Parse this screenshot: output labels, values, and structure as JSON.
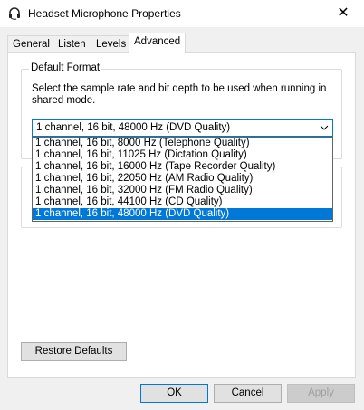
{
  "window": {
    "title": "Headset Microphone Properties",
    "close_label": "✕"
  },
  "tabs": [
    {
      "label": "General"
    },
    {
      "label": "Listen"
    },
    {
      "label": "Levels"
    },
    {
      "label": "Advanced",
      "active": true
    }
  ],
  "default_format": {
    "group_label": "Default Format",
    "description": "Select the sample rate and bit depth to be used when running in shared mode.",
    "selected_value": "1 channel, 16 bit, 48000 Hz (DVD Quality)",
    "options": [
      "1 channel, 16 bit, 8000 Hz (Telephone Quality)",
      "1 channel, 16 bit, 11025 Hz (Dictation Quality)",
      "1 channel, 16 bit, 16000 Hz (Tape Recorder Quality)",
      "1 channel, 16 bit, 22050 Hz (AM Radio Quality)",
      "1 channel, 16 bit, 32000 Hz (FM Radio Quality)",
      "1 channel, 16 bit, 44100 Hz (CD Quality)",
      "1 channel, 16 bit, 48000 Hz (DVD Quality)"
    ],
    "highlighted_option": "1 channel, 16 bit, 48000 Hz (DVD Quality)"
  },
  "buttons": {
    "restore_defaults": "Restore Defaults",
    "ok": "OK",
    "cancel": "Cancel",
    "apply": "Apply"
  },
  "colors": {
    "accent": "#0078d7",
    "window_bg": "#f0f0f0"
  }
}
